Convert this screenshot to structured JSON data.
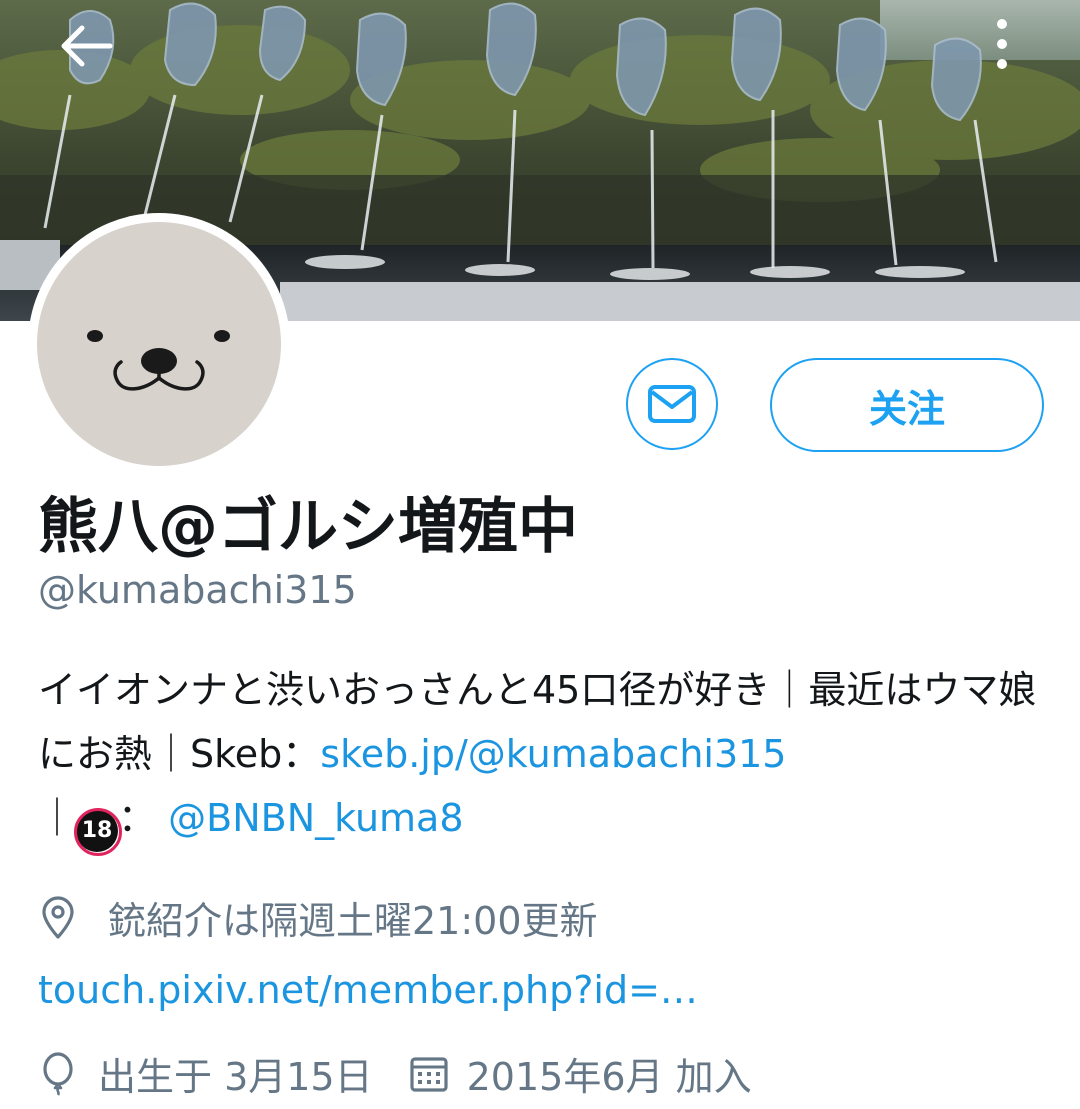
{
  "header": {
    "back_icon": "arrow-left-icon",
    "more_icon": "more-vertical-icon"
  },
  "profile": {
    "display_name": "熊八@ゴルシ増殖中",
    "handle": "@kumabachi315",
    "follow_label": "关注",
    "message_icon": "mail-icon",
    "bio": {
      "line_text": "イイオンナと渋いおっさんと45口径が好き｜最近はウマ娘にお熱｜Skeb：",
      "skeb_link": "skeb.jp/@kumabachi315",
      "separator": "｜",
      "nsfw_badge": "18",
      "colon": "：",
      "alt_account_link": "@BNBN_kuma8"
    },
    "location": "銃紹介は隔週土曜21:00更新",
    "website": "touch.pixiv.net/member.php?id=…",
    "birthday": "出生于 3月15日",
    "joined": "2015年6月 加入"
  },
  "colors": {
    "accent": "#1da1f2",
    "link": "#1b95e0",
    "secondary_text": "#657786"
  }
}
